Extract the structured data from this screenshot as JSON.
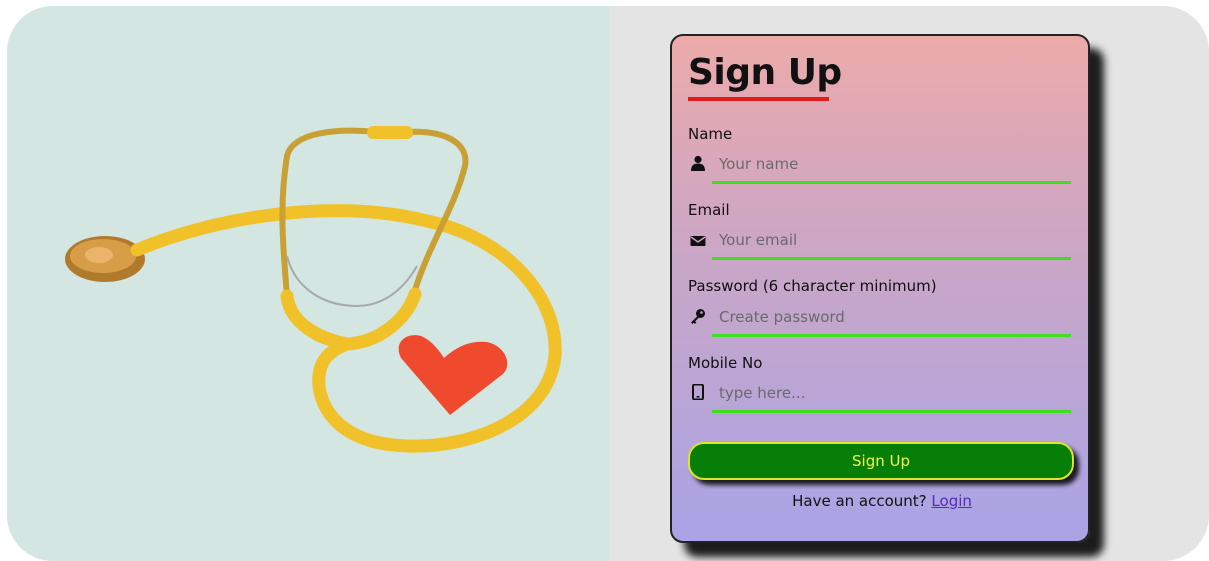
{
  "hero": {
    "image": "stethoscope-with-heart-photo"
  },
  "form": {
    "title": "Sign Up",
    "fields": [
      {
        "label": "Name",
        "icon": "user-icon",
        "placeholder": "Your name",
        "value": ""
      },
      {
        "label": "Email",
        "icon": "envelope-icon",
        "placeholder": "Your email",
        "value": ""
      },
      {
        "label": "Password (6 character minimum)",
        "icon": "key-icon",
        "placeholder": "Create password",
        "value": ""
      },
      {
        "label": "Mobile No",
        "icon": "mobile-phone-icon",
        "placeholder": "type here...",
        "value": ""
      }
    ],
    "submit_label": "Sign Up",
    "login_prompt": "Have an account?",
    "login_link": "Login"
  },
  "colors": {
    "card_gradient_top": "#ecaaaa",
    "card_gradient_bottom": "#a9a4e6",
    "title_underline": "#e41b1b",
    "input_underline": "#3fdf1f",
    "button_bg": "#067e08",
    "button_text": "#f4f34a",
    "link": "#5b2ab8"
  }
}
